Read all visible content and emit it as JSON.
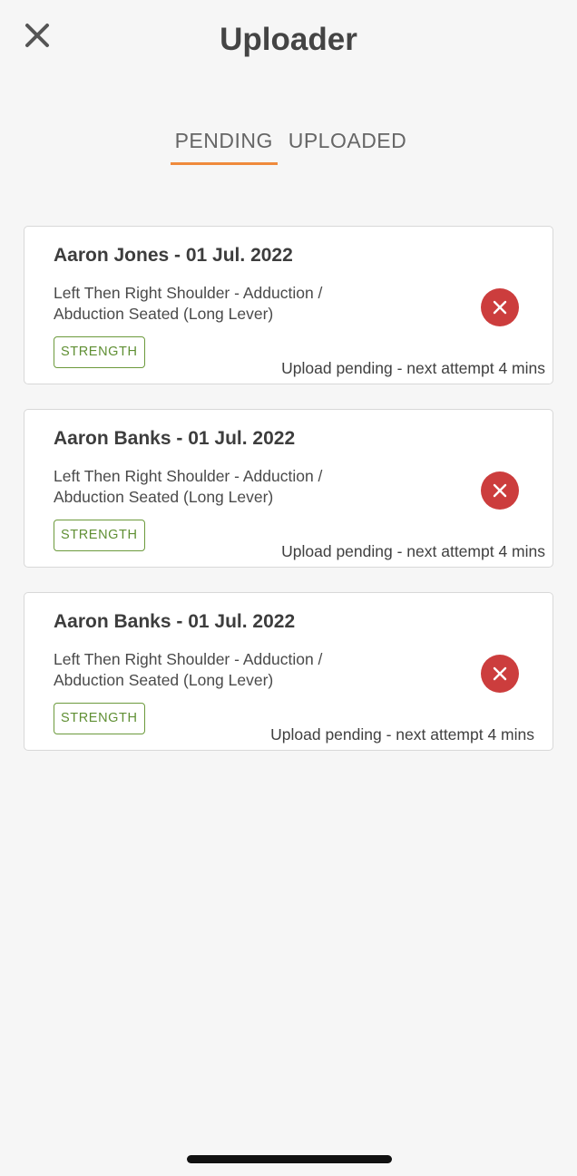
{
  "header": {
    "title": "Uploader",
    "close_icon": "close-icon"
  },
  "tabs": [
    {
      "label": "PENDING",
      "active": true
    },
    {
      "label": "UPLOADED",
      "active": false
    }
  ],
  "colors": {
    "accent": "#ef8a3c",
    "badge": "#5f8f33",
    "danger": "#cc3d3d",
    "background": "#f6f6f6"
  },
  "uploads": [
    {
      "title": "Aaron Jones - 01 Jul. 2022",
      "description_line1": "Left Then Right Shoulder - Adduction /",
      "description_line2": "Abduction Seated (Long Lever)",
      "badge": "STRENGTH",
      "status": "Upload pending - next attempt 4 mins",
      "remove_icon": "remove-x-icon"
    },
    {
      "title": "Aaron Banks - 01 Jul. 2022",
      "description_line1": "Left Then Right Shoulder - Adduction /",
      "description_line2": "Abduction Seated (Long Lever)",
      "badge": "STRENGTH",
      "status": "Upload pending - next attempt 4 mins",
      "remove_icon": "remove-x-icon"
    },
    {
      "title": "Aaron Banks - 01 Jul. 2022",
      "description_line1": "Left Then Right Shoulder - Adduction /",
      "description_line2": "Abduction Seated (Long Lever)",
      "badge": "STRENGTH",
      "status": "Upload pending - next attempt 4 mins",
      "remove_icon": "remove-x-icon"
    }
  ]
}
